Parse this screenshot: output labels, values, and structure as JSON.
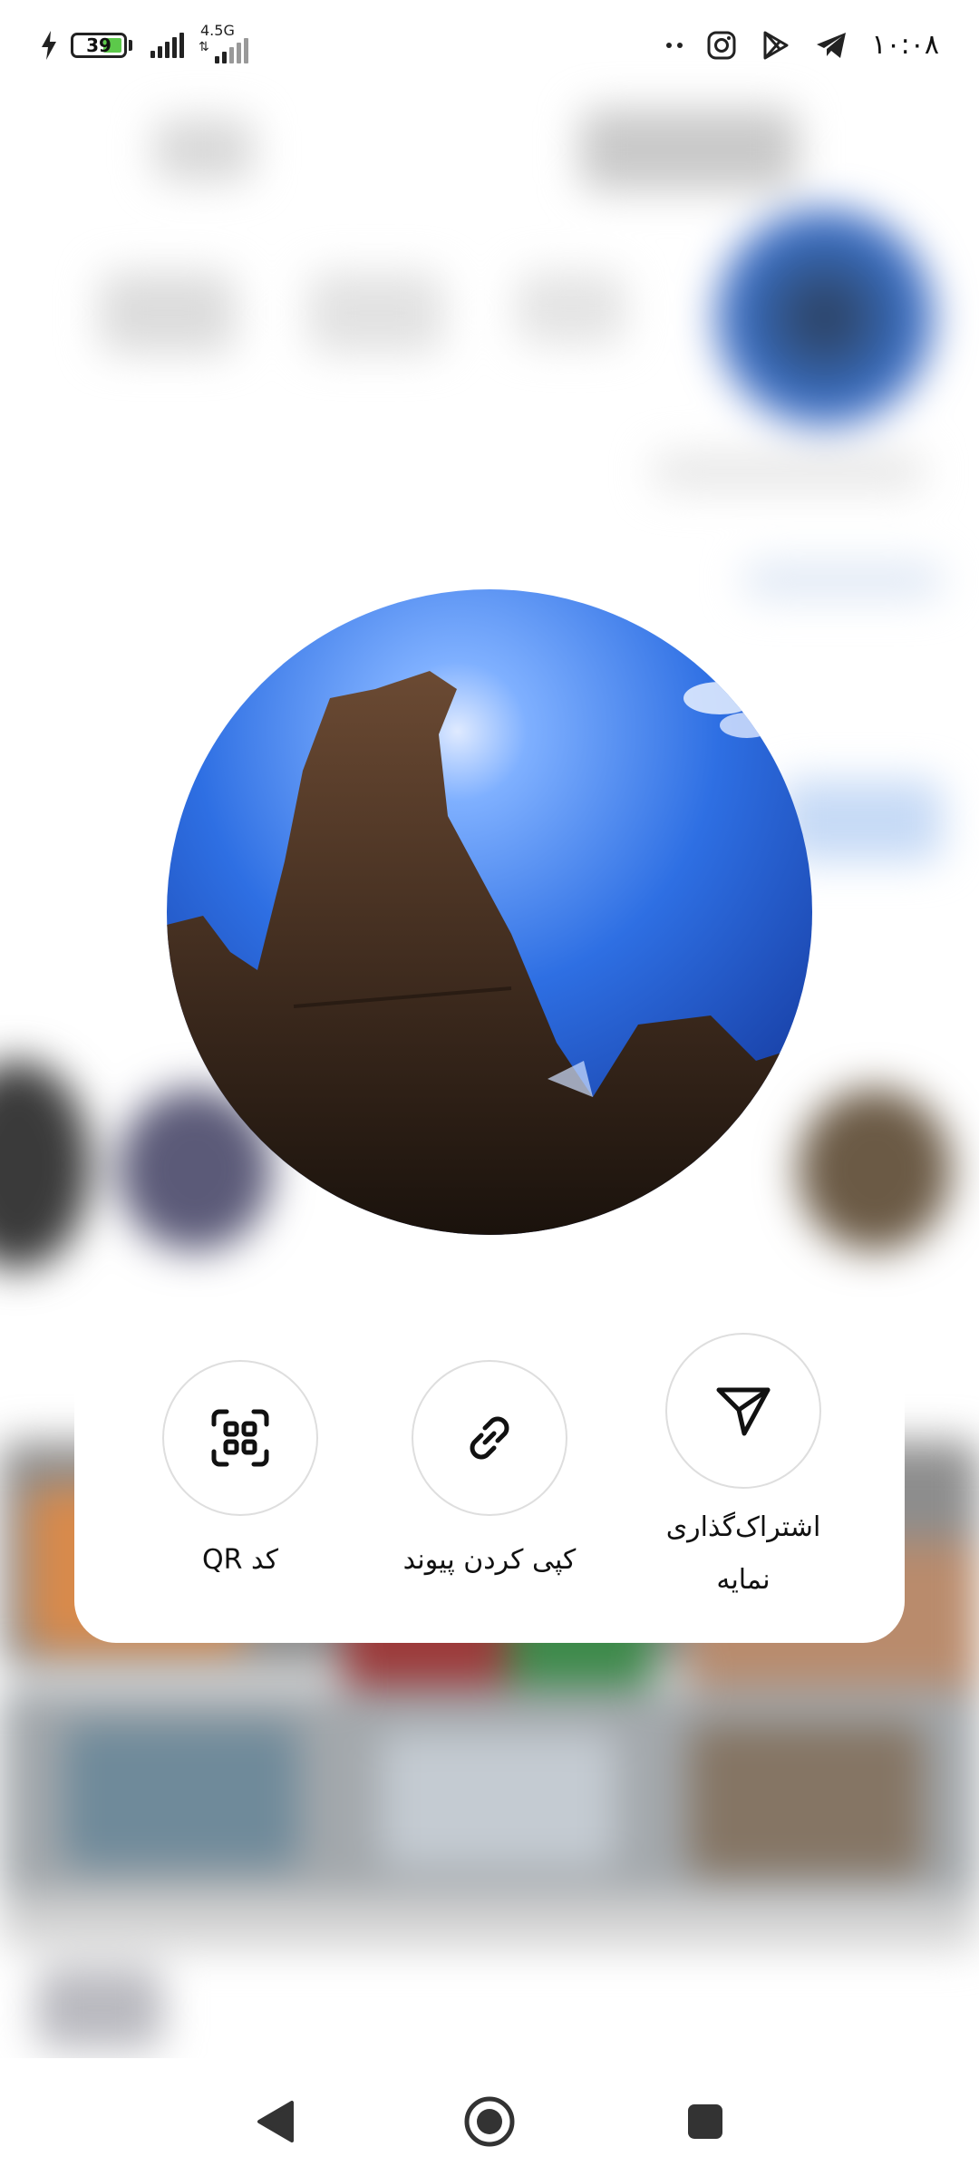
{
  "status_bar": {
    "battery_level": "39",
    "network_type": "4.5G",
    "time": "۱۰:۰۸",
    "icons": [
      "charging-icon",
      "battery-icon",
      "signal-icon",
      "signal-icon",
      "more-dots-icon",
      "instagram-icon",
      "google-play-icon",
      "telegram-icon"
    ]
  },
  "share_sheet": {
    "actions": [
      {
        "id": "share-profile",
        "icon": "send-icon",
        "label_line1": "اشتراک‌گذاری",
        "label_line2": "نمایه"
      },
      {
        "id": "copy-link",
        "icon": "link-icon",
        "label_line1": "کپی کردن پیوند"
      },
      {
        "id": "qr-code",
        "icon": "qr-code-icon",
        "label_line1": "کد QR"
      }
    ]
  },
  "nav_bar": {
    "buttons": [
      "back-icon",
      "home-icon",
      "recents-icon"
    ]
  },
  "colors": {
    "card_bg": "#ffffff",
    "circle_border": "#dedede",
    "battery_fill": "#5cc94a"
  }
}
